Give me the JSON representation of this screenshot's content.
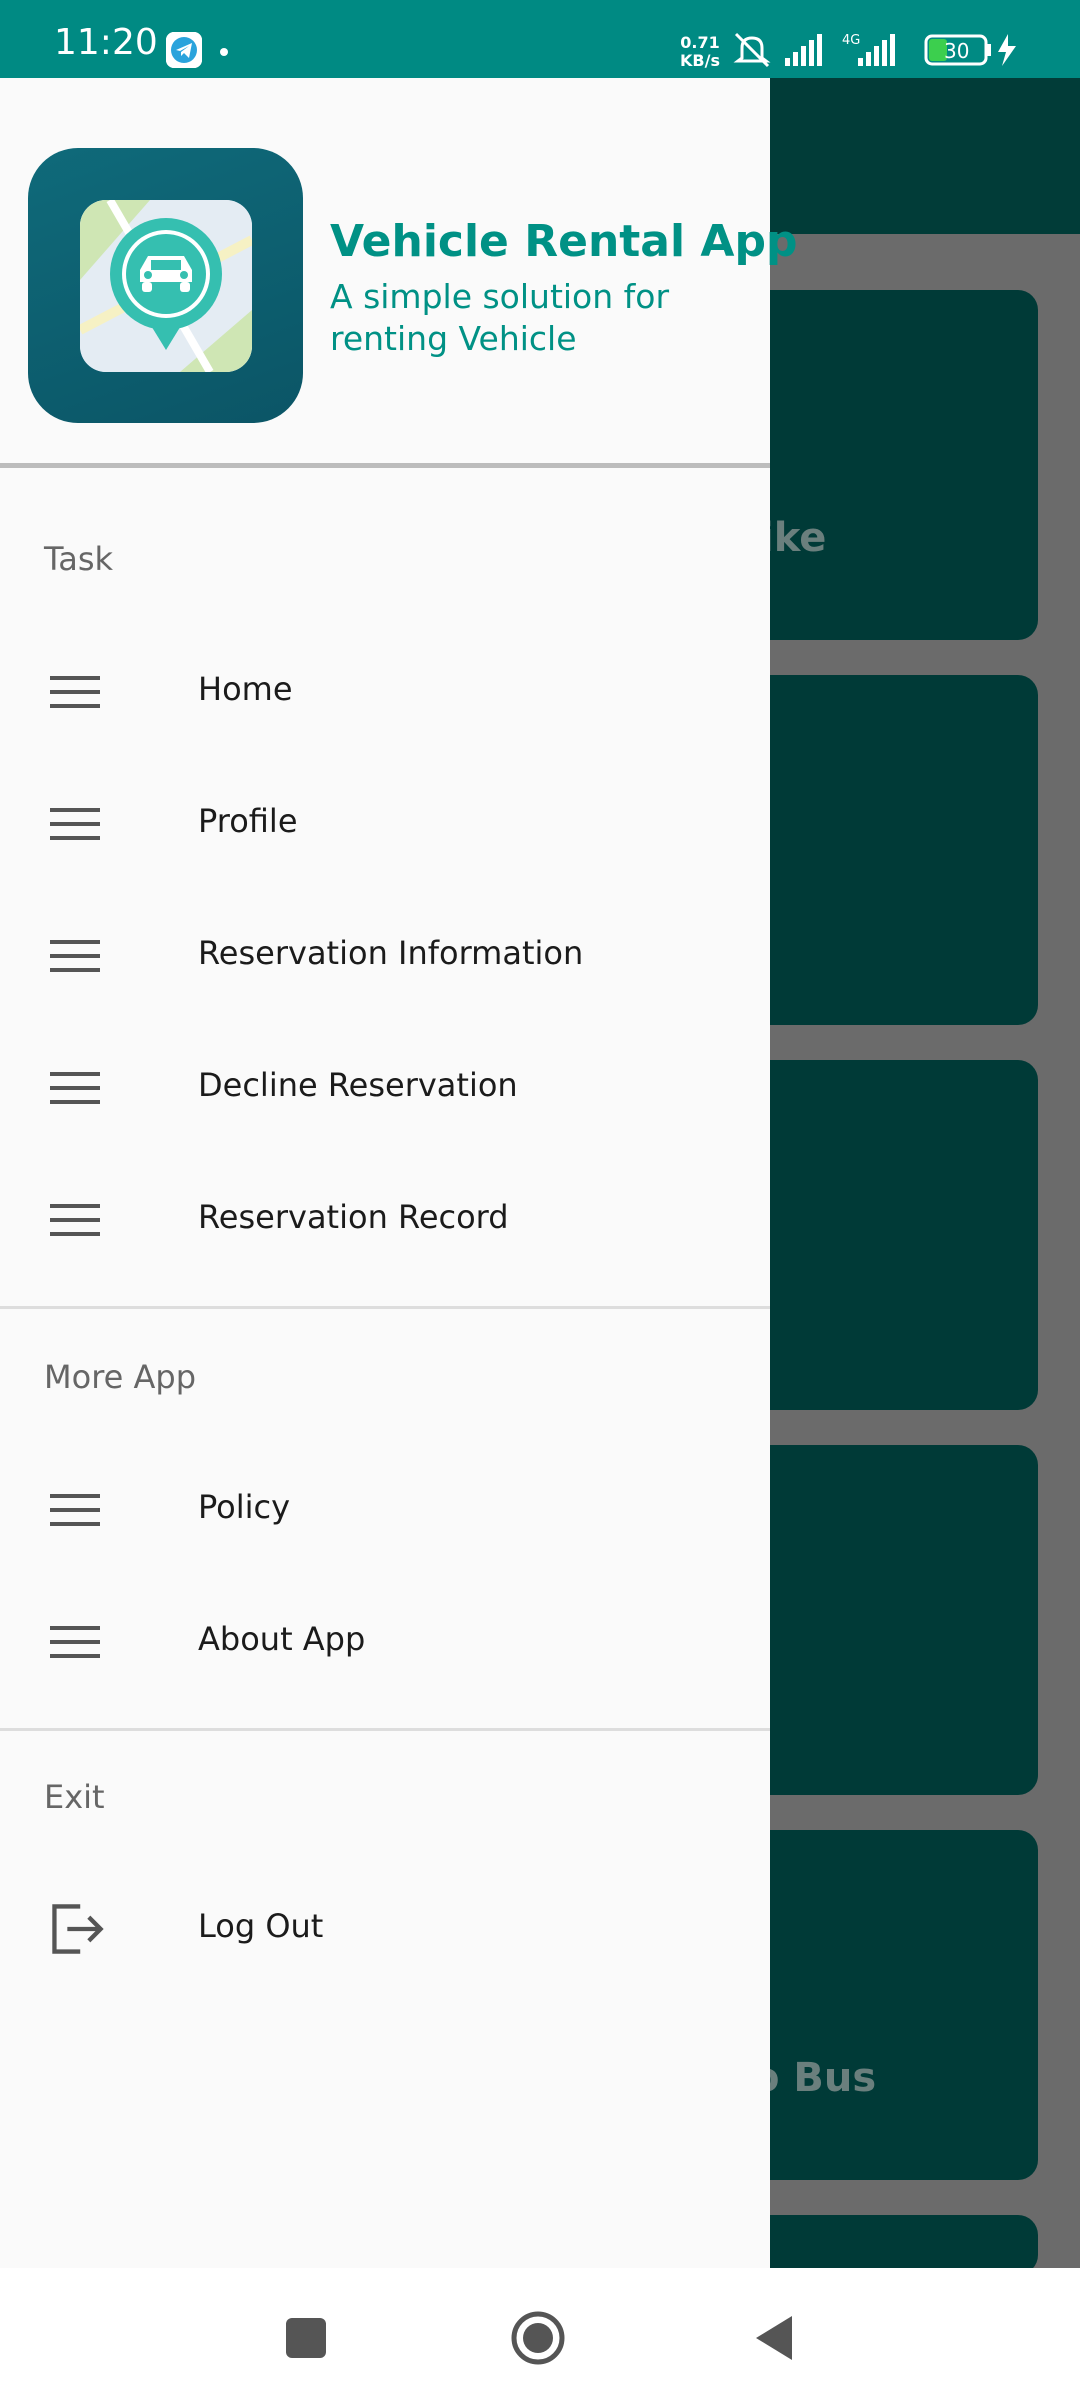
{
  "status_bar": {
    "time": "11:20",
    "net_speed_value": "0.71",
    "net_speed_unit": "KB/s",
    "network_type": "4G",
    "battery_level": "30",
    "bg_color": "#008a83"
  },
  "background": {
    "card_labels": [
      "ike",
      "o Bus"
    ]
  },
  "drawer": {
    "header": {
      "app_title": "Vehicle Rental App",
      "app_subtitle": "A simple solution for renting Vehicle",
      "accent_color": "#009185"
    },
    "sections": [
      {
        "label": "Task",
        "items": [
          {
            "label": "Home",
            "icon": "menu-icon"
          },
          {
            "label": "Profile",
            "icon": "menu-icon"
          },
          {
            "label": "Reservation Information",
            "icon": "menu-icon"
          },
          {
            "label": "Decline Reservation",
            "icon": "menu-icon"
          },
          {
            "label": "Reservation Record",
            "icon": "menu-icon"
          }
        ]
      },
      {
        "label": "More App",
        "items": [
          {
            "label": "Policy",
            "icon": "menu-icon"
          },
          {
            "label": "About App",
            "icon": "menu-icon"
          }
        ]
      },
      {
        "label": "Exit",
        "items": [
          {
            "label": "Log Out",
            "icon": "logout-icon"
          }
        ]
      }
    ]
  },
  "nav_bar": {
    "buttons": [
      "recent-apps",
      "home",
      "back"
    ]
  }
}
